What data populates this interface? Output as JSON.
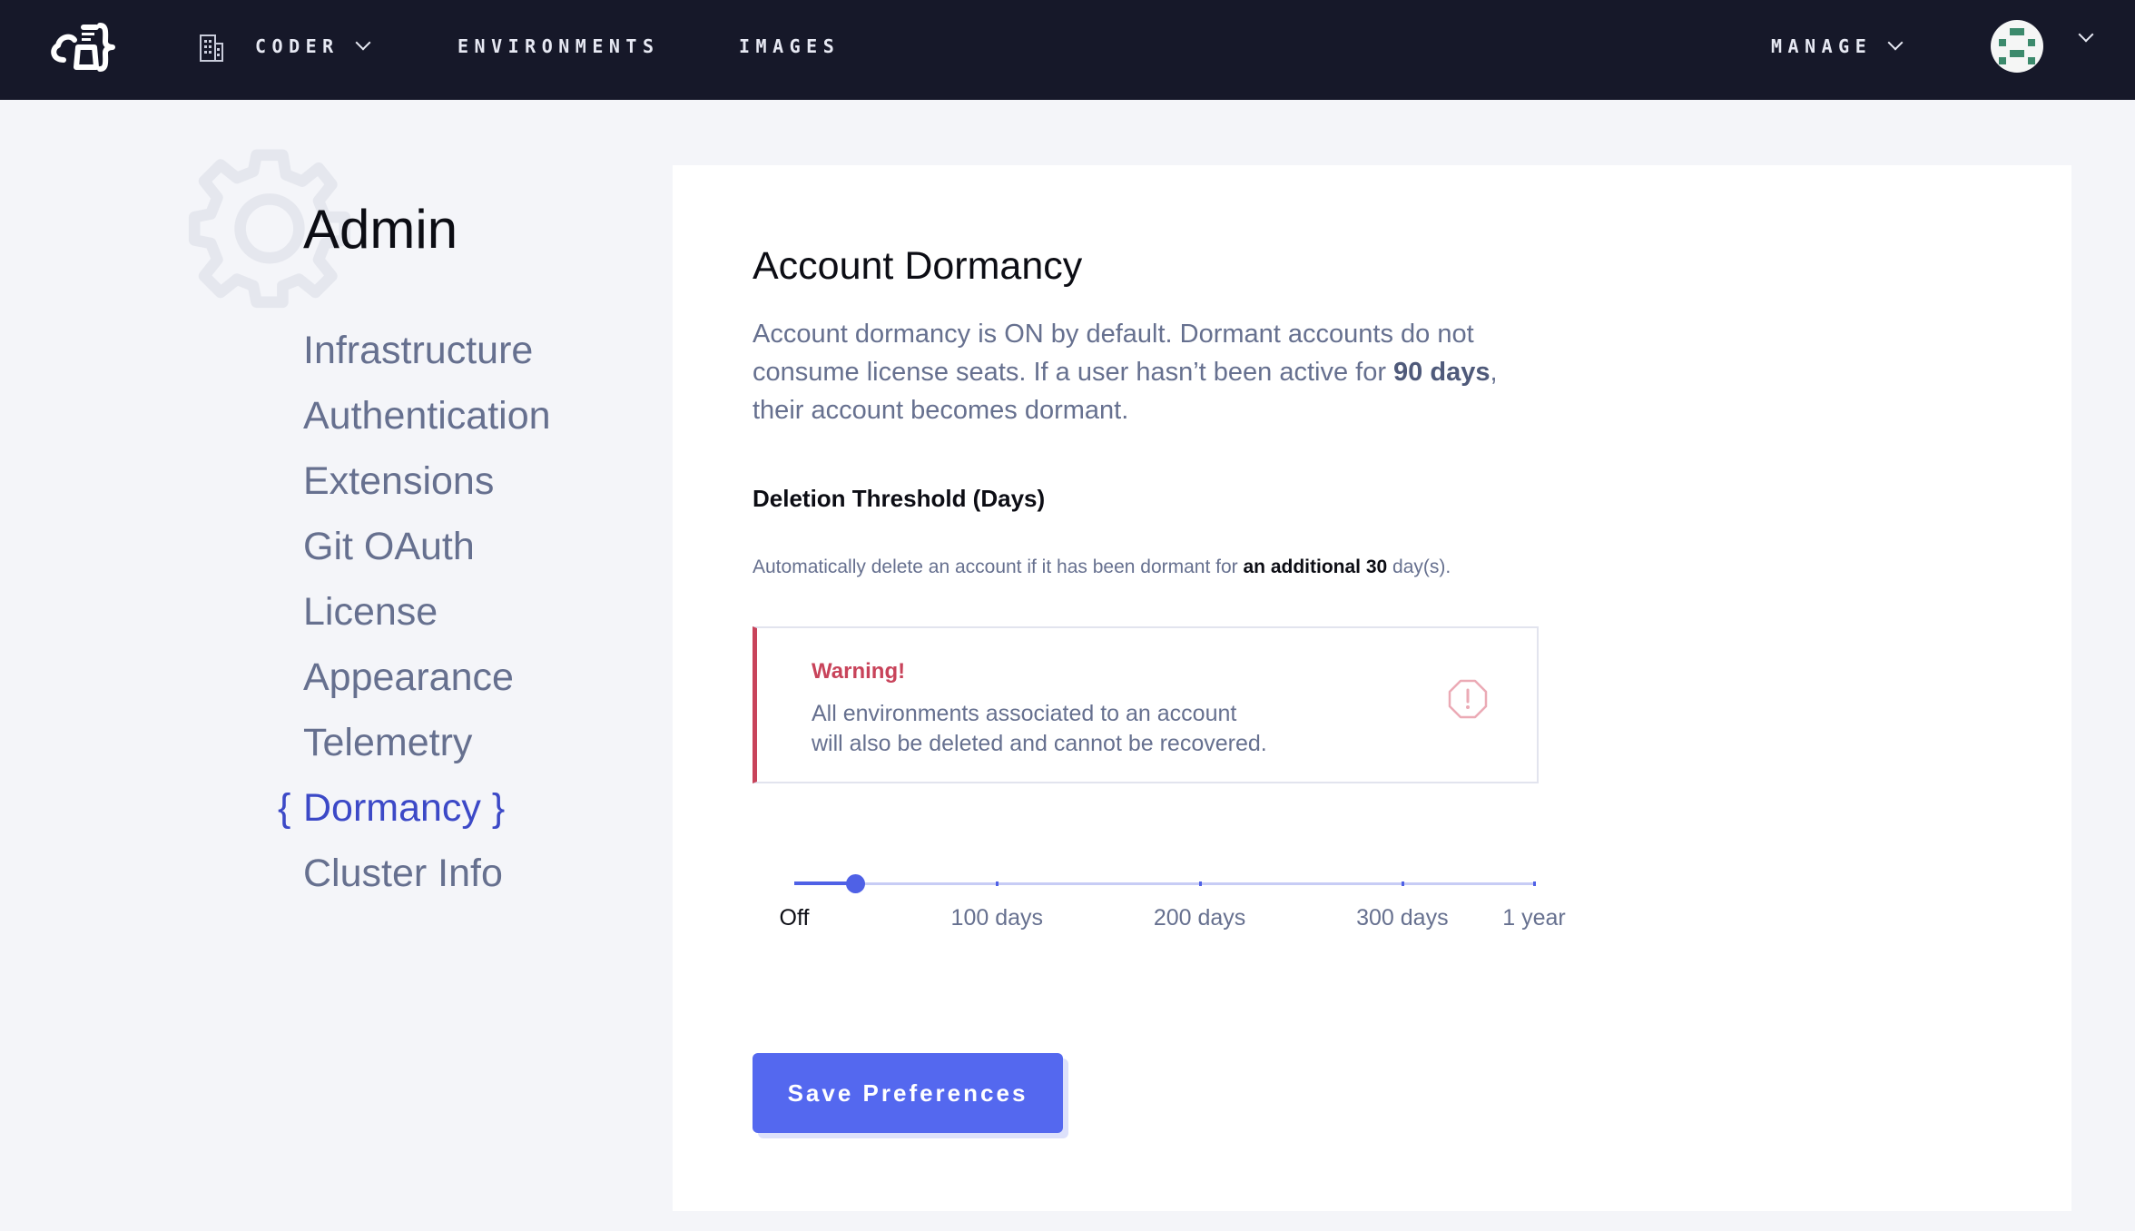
{
  "nav": {
    "org_label": "CODER",
    "environments_label": "ENVIRONMENTS",
    "images_label": "IMAGES",
    "manage_label": "MANAGE"
  },
  "sidebar": {
    "title": "Admin",
    "items": [
      {
        "label": "Infrastructure"
      },
      {
        "label": "Authentication"
      },
      {
        "label": "Extensions"
      },
      {
        "label": "Git OAuth"
      },
      {
        "label": "License"
      },
      {
        "label": "Appearance"
      },
      {
        "label": "Telemetry"
      },
      {
        "label": "Dormancy",
        "active": true
      },
      {
        "label": "Cluster Info"
      }
    ],
    "active_brace_open": "{",
    "active_brace_close": "}"
  },
  "dormancy": {
    "title": "Account Dormancy",
    "desc_part1": "Account dormancy is ON by default. Dormant accounts do not consume license seats. If a user hasn’t been active for ",
    "desc_bold": "90 days",
    "desc_part2": ", their account becomes dormant.",
    "threshold_label": "Deletion Threshold (Days)",
    "help_part1": "Automatically delete an account if it has been dormant for ",
    "help_bold": "an additional 30",
    "help_part2": " day(s).",
    "warning_title": "Warning!",
    "warning_line1": "All environments associated to an account",
    "warning_line2": "will also be deleted and cannot be recovered.",
    "slider": {
      "min": 0,
      "max": 365,
      "value": 30,
      "unit": "days",
      "marks": [
        {
          "value": 0,
          "label": "Off"
        },
        {
          "value": 100,
          "label": "100 days"
        },
        {
          "value": 200,
          "label": "200 days"
        },
        {
          "value": 300,
          "label": "300 days"
        },
        {
          "value": 365,
          "label": "1 year"
        }
      ]
    },
    "save_label": "Save Preferences"
  },
  "colors": {
    "nav_bg": "#161829",
    "accent": "#4f61e6",
    "warning": "#c8435a",
    "muted_text": "#66708f"
  },
  "icons": {
    "logo": "coder-logo-icon",
    "org": "building-icon",
    "avatar": "user-avatar-identicon",
    "admin": "gear-icon",
    "warning": "alert-octagon-icon"
  }
}
